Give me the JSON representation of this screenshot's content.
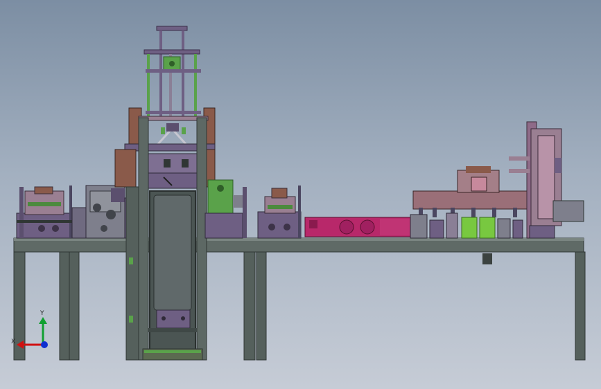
{
  "viewport": {
    "background_top": "#7c8ea3",
    "background_bottom": "#c6ccd6"
  },
  "model": {
    "colors": {
      "frame": "#4f5a57",
      "frame_dark": "#2f3634",
      "tabletop": "#5f6a66",
      "purple": "#6e5f83",
      "mauve": "#9a7f92",
      "brown": "#8a5a4a",
      "green": "#5aa24a",
      "bright_green": "#78c840",
      "magenta": "#b8286a",
      "rose": "#c7899c",
      "steel": "#8d9590"
    }
  },
  "triad": {
    "x_label": "X",
    "y_label": "Y",
    "x_color": "#d01010",
    "y_color": "#10a030",
    "z_color": "#1030d0"
  }
}
